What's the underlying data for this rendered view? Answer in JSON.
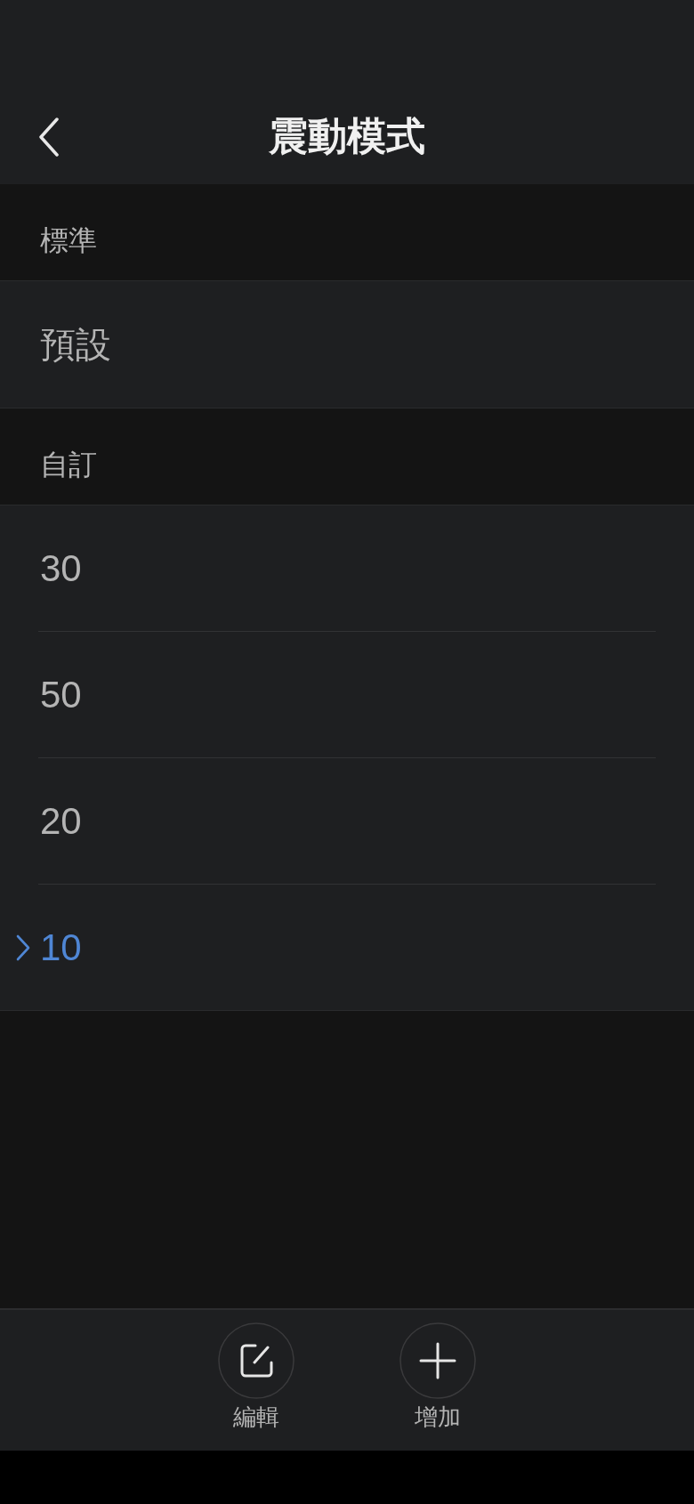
{
  "header": {
    "title": "震動模式"
  },
  "sections": [
    {
      "label": "標準",
      "items": [
        {
          "label": "預設",
          "selected": false
        }
      ]
    },
    {
      "label": "自訂",
      "items": [
        {
          "label": "30",
          "selected": false
        },
        {
          "label": "50",
          "selected": false
        },
        {
          "label": "20",
          "selected": false
        },
        {
          "label": "10",
          "selected": true
        }
      ]
    }
  ],
  "toolbar": {
    "buttons": [
      {
        "kind": "edit",
        "label": "編輯"
      },
      {
        "kind": "add",
        "label": "增加"
      }
    ]
  }
}
